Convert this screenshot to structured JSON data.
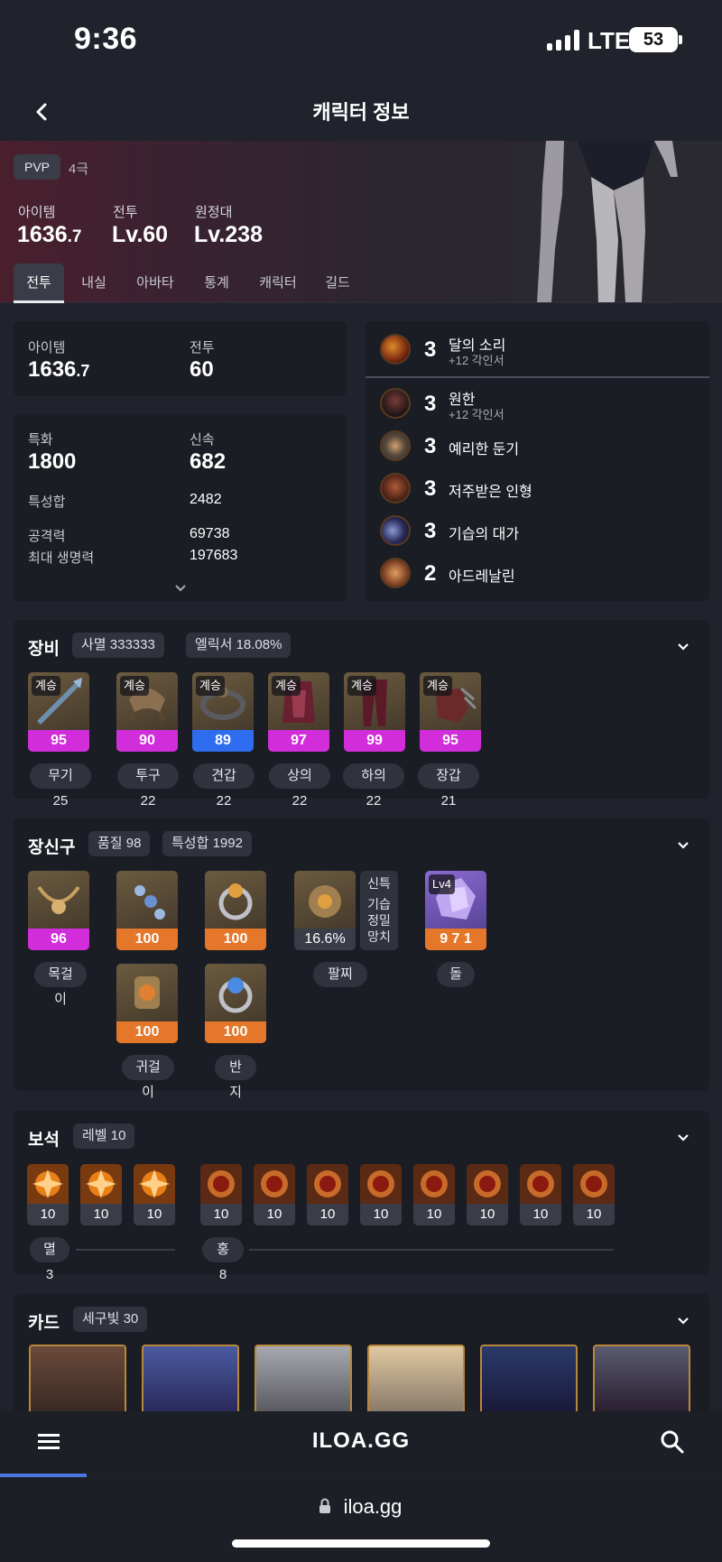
{
  "status": {
    "time": "9:36",
    "network": "LTE",
    "battery": "53"
  },
  "nav": {
    "title": "캐릭터 정보"
  },
  "hero": {
    "pvp_label": "PVP",
    "pvp_rank": "4극",
    "stats": [
      {
        "label": "아이템",
        "value": "1636",
        "decimal": ".7"
      },
      {
        "label": "전투",
        "value": "Lv.60",
        "decimal": ""
      },
      {
        "label": "원정대",
        "value": "Lv.238",
        "decimal": ""
      }
    ]
  },
  "tabs": [
    "전투",
    "내실",
    "아바타",
    "통계",
    "캐릭터",
    "길드"
  ],
  "summary": {
    "item_label": "아이템",
    "item_value": "1636",
    "item_decimal": ".7",
    "combat_label": "전투",
    "combat_value": "60"
  },
  "stats": {
    "spec_label": "특화",
    "spec_value": "1800",
    "swift_label": "신속",
    "swift_value": "682",
    "total_label": "특성합",
    "total_value": "2482",
    "atk_label": "공격력",
    "atk_value": "69738",
    "hp_label": "최대 생명력",
    "hp_value": "197683"
  },
  "engravings": [
    {
      "level": "3",
      "name": "달의 소리",
      "sub": "+12 각인서",
      "icon": "moon-sound-icon"
    },
    {
      "level": "3",
      "name": "원한",
      "sub": "+12 각인서",
      "icon": "grudge-icon"
    },
    {
      "level": "3",
      "name": "예리한 둔기",
      "sub": "",
      "icon": "keen-blunt-icon"
    },
    {
      "level": "3",
      "name": "저주받은 인형",
      "sub": "",
      "icon": "cursed-doll-icon"
    },
    {
      "level": "3",
      "name": "기습의 대가",
      "sub": "",
      "icon": "ambush-master-icon"
    },
    {
      "level": "2",
      "name": "아드레날린",
      "sub": "",
      "icon": "adrenaline-icon"
    }
  ],
  "equipment": {
    "title": "장비",
    "chips": [
      "사멸 333333",
      "엘릭서 18.08%"
    ],
    "items": [
      {
        "tag": "계승",
        "quality": "95",
        "label": "무기 25",
        "color": "pink"
      },
      {
        "tag": "계승",
        "quality": "90",
        "label": "투구 22",
        "color": "pink"
      },
      {
        "tag": "계승",
        "quality": "89",
        "label": "견갑 22",
        "color": "blue"
      },
      {
        "tag": "계승",
        "quality": "97",
        "label": "상의 22",
        "color": "pink"
      },
      {
        "tag": "계승",
        "quality": "99",
        "label": "하의 22",
        "color": "pink"
      },
      {
        "tag": "계승",
        "quality": "95",
        "label": "장갑 21",
        "color": "pink"
      }
    ]
  },
  "accessories": {
    "title": "장신구",
    "chips": [
      "품질 98",
      "특성합 1992"
    ],
    "necklace": {
      "quality": "96",
      "label": "목걸이"
    },
    "earring_quality": [
      "100",
      "100"
    ],
    "earring_label": "귀걸이",
    "ring_quality": [
      "100",
      "100"
    ],
    "ring_label": "반지",
    "bracelet": {
      "value": "16.6%",
      "label": "팔찌",
      "effects": [
        "신특",
        "기습",
        "정밀",
        "망치"
      ]
    },
    "stone": {
      "tag": "Lv4",
      "value": "9 7 1",
      "label": "돌"
    }
  },
  "gems": {
    "title": "보석",
    "chip": "레벨 10",
    "left": [
      "10",
      "10",
      "10"
    ],
    "right": [
      "10",
      "10",
      "10",
      "10",
      "10",
      "10",
      "10",
      "10"
    ],
    "left_label": "멸 3",
    "right_label": "홍 8"
  },
  "cards": {
    "title": "카드",
    "chip": "세구빛 30"
  },
  "bottom": {
    "logo": "ILOA.GG",
    "url": "iloa.gg"
  },
  "colors": {
    "pink": "#d12ddb",
    "blue": "#2f6df0",
    "orange": "#e4772a",
    "bg": "#20232c",
    "panel": "#1a1d24"
  }
}
